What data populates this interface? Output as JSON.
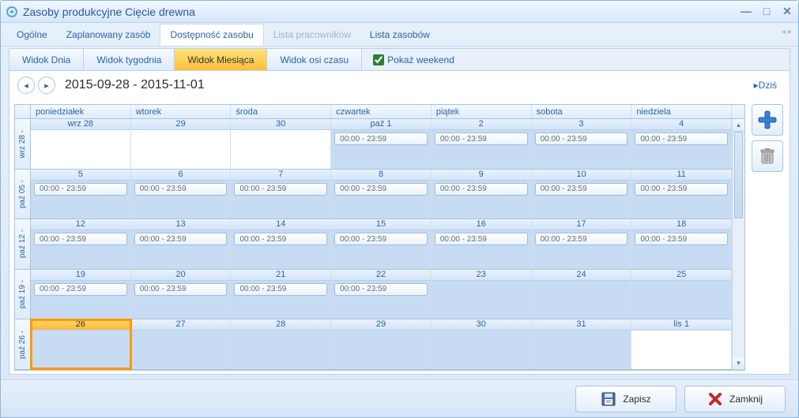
{
  "window": {
    "title": "Zasoby produkcyjne Cięcie drewna"
  },
  "mainTabs": {
    "general": "Ogólne",
    "planned": "Zaplanowany zasób",
    "availability": "Dostępność zasobu",
    "workers": "Lista pracowników",
    "resources": "Lista zasobów"
  },
  "viewTabs": {
    "day": "Widok Dnia",
    "week": "Widok tygodnia",
    "month": "Widok Miesiąca",
    "timeline": "Widok osi czasu",
    "weekend": "Pokaż weekend"
  },
  "nav": {
    "range": "2015-09-28 - 2015-11-01",
    "today": "Dziś"
  },
  "days": [
    "poniedziałek",
    "wtorek",
    "środa",
    "czwartek",
    "piątek",
    "sobota",
    "niedziela"
  ],
  "weekLabels": [
    "wrz 28 -",
    "paź 05 -",
    "paź 12 -",
    "paź 19 -",
    "paź 26 -"
  ],
  "cells": [
    [
      {
        "label": "wrz 28",
        "ev": null,
        "white": true
      },
      {
        "label": "29",
        "ev": null,
        "white": true
      },
      {
        "label": "30",
        "ev": null,
        "white": true
      },
      {
        "label": "paź 1",
        "ev": "00:00 - 23:59"
      },
      {
        "label": "2",
        "ev": "00:00 - 23:59"
      },
      {
        "label": "3",
        "ev": "00:00 - 23:59"
      },
      {
        "label": "4",
        "ev": "00:00 - 23:59"
      }
    ],
    [
      {
        "label": "5",
        "ev": "00:00 - 23:59"
      },
      {
        "label": "6",
        "ev": "00:00 - 23:59"
      },
      {
        "label": "7",
        "ev": "00:00 - 23:59"
      },
      {
        "label": "8",
        "ev": "00:00 - 23:59"
      },
      {
        "label": "9",
        "ev": "00:00 - 23:59"
      },
      {
        "label": "10",
        "ev": "00:00 - 23:59"
      },
      {
        "label": "11",
        "ev": "00:00 - 23:59"
      }
    ],
    [
      {
        "label": "12",
        "ev": "00:00 - 23:59"
      },
      {
        "label": "13",
        "ev": "00:00 - 23:59"
      },
      {
        "label": "14",
        "ev": "00:00 - 23:59"
      },
      {
        "label": "15",
        "ev": "00:00 - 23:59"
      },
      {
        "label": "16",
        "ev": "00:00 - 23:59"
      },
      {
        "label": "17",
        "ev": "00:00 - 23:59"
      },
      {
        "label": "18",
        "ev": "00:00 - 23:59"
      }
    ],
    [
      {
        "label": "19",
        "ev": "00:00 - 23:59"
      },
      {
        "label": "20",
        "ev": "00:00 - 23:59"
      },
      {
        "label": "21",
        "ev": "00:00 - 23:59"
      },
      {
        "label": "22",
        "ev": "00:00 - 23:59"
      },
      {
        "label": "23",
        "ev": null
      },
      {
        "label": "24",
        "ev": null
      },
      {
        "label": "25",
        "ev": null
      }
    ],
    [
      {
        "label": "26",
        "ev": null,
        "today": true
      },
      {
        "label": "27",
        "ev": null
      },
      {
        "label": "28",
        "ev": null
      },
      {
        "label": "29",
        "ev": null
      },
      {
        "label": "30",
        "ev": null
      },
      {
        "label": "31",
        "ev": null
      },
      {
        "label": "lis 1",
        "ev": null,
        "white": true
      }
    ]
  ],
  "footer": {
    "save": "Zapisz",
    "close": "Zamknij"
  }
}
